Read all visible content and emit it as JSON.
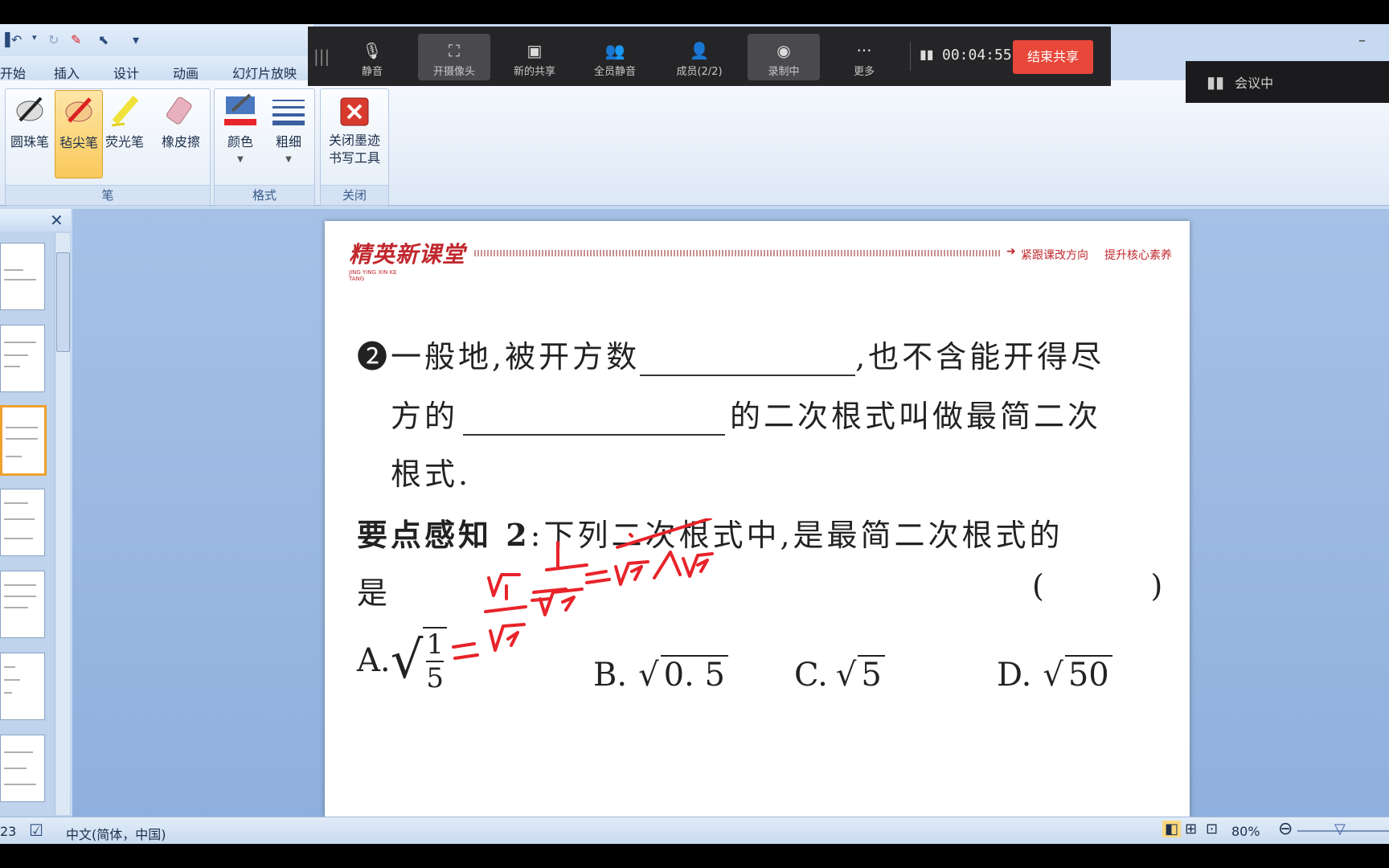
{
  "quick_access": {
    "customize_label": "▾"
  },
  "ribbon_tabs": [
    "开始",
    "插入",
    "设计",
    "动画",
    "幻灯片放映"
  ],
  "ribbon": {
    "pen_group": {
      "label": "笔",
      "tools": [
        "圆珠笔",
        "毡尖笔",
        "荧光笔",
        "橡皮擦"
      ]
    },
    "format_group": {
      "label": "格式",
      "tools": [
        "颜色",
        "粗细"
      ]
    },
    "close_group": {
      "label": "关闭",
      "button": "关闭墨迹书写工具"
    },
    "minimize": "–"
  },
  "meeting_toolbar": {
    "buttons": [
      "静音",
      "开摄像头",
      "新的共享",
      "全员静音",
      "成员(2/2)",
      "录制中",
      "更多"
    ],
    "timer": "00:04:55",
    "end_share": "结束共享",
    "status": "会议中"
  },
  "slide": {
    "header_brand": "精英新课堂",
    "header_brand_sub": "JING YING XIN KE TANG",
    "header_slogan_1": "紧跟课改方向",
    "header_slogan_2": "提升核心素养",
    "line1_prefix": "❷一般地,被开方数",
    "line1_suffix": ",也不含能开得尽",
    "line2_prefix": "方的",
    "line2_suffix": "的二次根式叫做最简二次",
    "line3": "根式.",
    "point_label": "要点感知 2",
    "point_text": ":下列二次根式中,是最简二次根式的",
    "line5": "是",
    "paren": "(        )",
    "options": {
      "a_label": "A.",
      "a_num": "1",
      "a_den": "5",
      "b_label": "B.",
      "b_val": "0. 5",
      "c_label": "C.",
      "c_val": "5",
      "d_label": "D.",
      "d_val": "50"
    }
  },
  "status_bar": {
    "slide_no": "23",
    "language": "中文(简体，中国)",
    "zoom": "80%"
  },
  "colors": {
    "ink": "#e8232a",
    "end_share": "#e8473a",
    "brand": "#c0282e"
  }
}
